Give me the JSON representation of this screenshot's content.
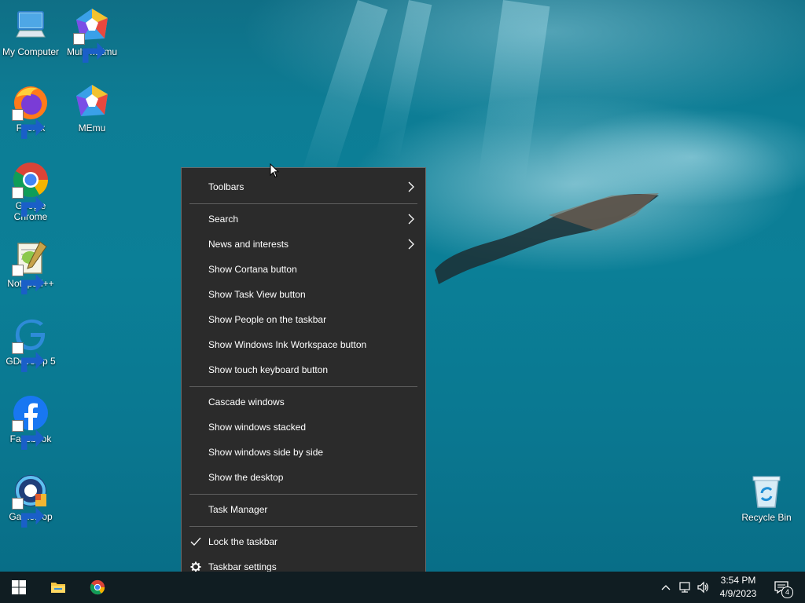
{
  "desktop": {
    "icons": [
      {
        "label": "My Computer",
        "icon": "computer-icon"
      },
      {
        "label": "Multi-MEmu",
        "icon": "multi-memu-icon"
      },
      {
        "label": "Firefox",
        "icon": "firefox-icon"
      },
      {
        "label": "MEmu",
        "icon": "memu-icon"
      },
      {
        "label": "Google Chrome",
        "icon": "chrome-icon"
      },
      {
        "label": "Notepad++",
        "icon": "notepad-plus-plus-icon"
      },
      {
        "label": "GDevelop 5",
        "icon": "gdevelop-icon"
      },
      {
        "label": "Facebook",
        "icon": "facebook-icon"
      },
      {
        "label": "Gameloop",
        "icon": "gameloop-icon"
      },
      {
        "label": "Recycle Bin",
        "icon": "recycle-bin-icon"
      }
    ]
  },
  "context_menu": {
    "items": [
      {
        "label": "Toolbars",
        "submenu": true
      },
      {
        "label": "Search",
        "submenu": true
      },
      {
        "label": "News and interests",
        "submenu": true
      },
      {
        "label": "Show Cortana button"
      },
      {
        "label": "Show Task View button"
      },
      {
        "label": "Show People on the taskbar"
      },
      {
        "label": "Show Windows Ink Workspace button"
      },
      {
        "label": "Show touch keyboard button"
      },
      {
        "label": "Cascade windows"
      },
      {
        "label": "Show windows stacked"
      },
      {
        "label": "Show windows side by side"
      },
      {
        "label": "Show the desktop"
      },
      {
        "label": "Task Manager"
      },
      {
        "label": "Lock the taskbar",
        "checked": true
      },
      {
        "label": "Taskbar settings",
        "icon": "gear-icon"
      }
    ]
  },
  "taskbar": {
    "pinned": [
      {
        "icon": "windows-start-icon"
      },
      {
        "icon": "file-explorer-icon"
      },
      {
        "icon": "chrome-icon"
      }
    ],
    "tray": {
      "icons": [
        "chevron-up-icon",
        "network-icon",
        "volume-icon"
      ],
      "time": "3:54 PM",
      "date": "4/9/2023",
      "notification_count": "4"
    }
  },
  "colors": {
    "menu_bg": "#2b2b2b",
    "taskbar_bg": "#101d22",
    "desktop_water": "#0b7f97"
  }
}
